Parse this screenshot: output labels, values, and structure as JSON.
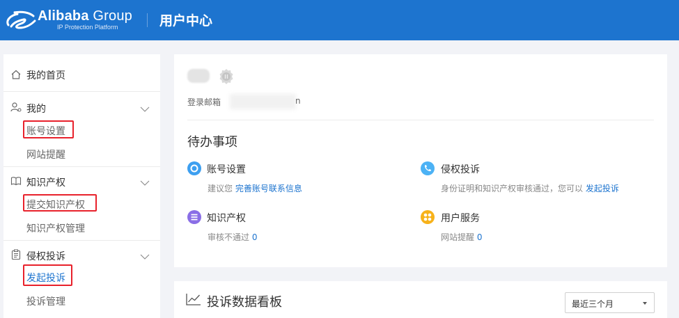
{
  "header": {
    "logo_word": "Alibaba",
    "logo_word2": " Group",
    "logo_sub": "IP Protection Platform",
    "title": "用户中心",
    "bg_color": "#1d74cf"
  },
  "sidebar": {
    "home": {
      "label": "我的首页",
      "icon": "home-icon"
    },
    "sections": [
      {
        "label": "我的",
        "icon": "user-gear-icon",
        "items": [
          "账号设置",
          "网站提醒"
        ]
      },
      {
        "label": "知识产权",
        "icon": "book-icon",
        "items": [
          "提交知识产权",
          "知识产权管理"
        ]
      },
      {
        "label": "侵权投诉",
        "icon": "clipboard-icon",
        "items": [
          "发起投诉",
          "投诉管理"
        ]
      }
    ],
    "highlighted_items": [
      "账号设置",
      "提交知识产权",
      "发起投诉"
    ],
    "active_item": "发起投诉",
    "highlight_color": "#e8212b"
  },
  "profile": {
    "email_label": "登录邮箱",
    "email_tail": "n"
  },
  "todo": {
    "title": "待办事项",
    "items": [
      {
        "title": "账号设置",
        "icon": "settings-circle-icon",
        "color": "#3d9ff0",
        "desc": "建议您 ",
        "link": "完善账号联系信息"
      },
      {
        "title": "侵权投诉",
        "icon": "phone-circle-icon",
        "color": "#4cb2f5",
        "desc": "身份证明和知识产权审核通过，您可以 ",
        "link": "发起投诉"
      },
      {
        "title": "知识产权",
        "icon": "list-circle-icon",
        "color": "#8a6ee6",
        "desc": "审核不通过 ",
        "link": "0"
      },
      {
        "title": "用户服务",
        "icon": "grid-circle-icon",
        "color": "#f7b21a",
        "desc": "网站提醒 ",
        "link": "0"
      }
    ]
  },
  "dashboard": {
    "title": "投诉数据看板",
    "icon": "line-chart-icon",
    "range_select": "最近三个月"
  }
}
